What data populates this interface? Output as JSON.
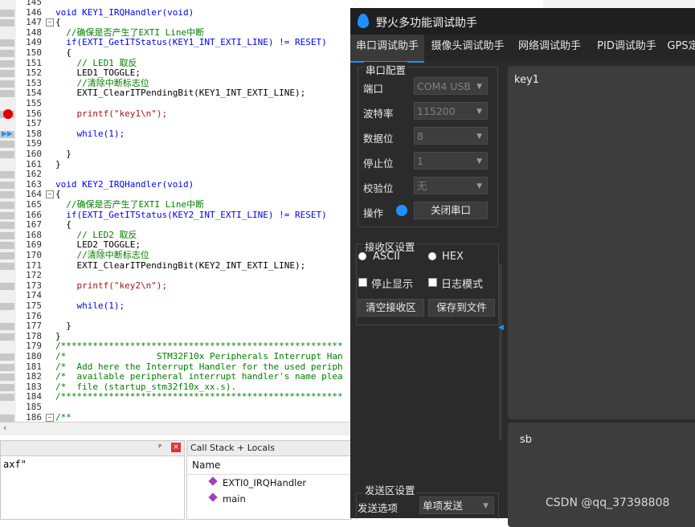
{
  "editor": {
    "lines": [
      {
        "n": "145",
        "t": ""
      },
      {
        "n": "146",
        "t": "void KEY1_IRQHandler(void)"
      },
      {
        "n": "147",
        "t": "{"
      },
      {
        "n": "148",
        "t": "  //确保是否产生了EXTI Line中断"
      },
      {
        "n": "149",
        "t": "  if(EXTI_GetITStatus(KEY1_INT_EXTI_LINE) != RESET)"
      },
      {
        "n": "150",
        "t": "  {"
      },
      {
        "n": "151",
        "t": "    // LED1 取反"
      },
      {
        "n": "152",
        "t": "    LED1_TOGGLE;"
      },
      {
        "n": "153",
        "t": "    //清除中断标志位"
      },
      {
        "n": "154",
        "t": "    EXTI_ClearITPendingBit(KEY1_INT_EXTI_LINE);"
      },
      {
        "n": "155",
        "t": ""
      },
      {
        "n": "156",
        "t": "    printf(\"key1\\n\");"
      },
      {
        "n": "157",
        "t": ""
      },
      {
        "n": "158",
        "t": "    while(1);"
      },
      {
        "n": "159",
        "t": ""
      },
      {
        "n": "160",
        "t": "  }"
      },
      {
        "n": "161",
        "t": "}"
      },
      {
        "n": "162",
        "t": ""
      },
      {
        "n": "163",
        "t": "void KEY2_IRQHandler(void)"
      },
      {
        "n": "164",
        "t": "{"
      },
      {
        "n": "165",
        "t": "  //确保是否产生了EXTI Line中断"
      },
      {
        "n": "166",
        "t": "  if(EXTI_GetITStatus(KEY2_INT_EXTI_LINE) != RESET)"
      },
      {
        "n": "167",
        "t": "  {"
      },
      {
        "n": "168",
        "t": "    // LED2 取反"
      },
      {
        "n": "169",
        "t": "    LED2_TOGGLE;"
      },
      {
        "n": "170",
        "t": "    //清除中断标志位"
      },
      {
        "n": "171",
        "t": "    EXTI_ClearITPendingBit(KEY2_INT_EXTI_LINE);"
      },
      {
        "n": "172",
        "t": ""
      },
      {
        "n": "173",
        "t": "    printf(\"key2\\n\");"
      },
      {
        "n": "174",
        "t": ""
      },
      {
        "n": "175",
        "t": "    while(1);"
      },
      {
        "n": "176",
        "t": ""
      },
      {
        "n": "177",
        "t": "  }"
      },
      {
        "n": "178",
        "t": "}"
      },
      {
        "n": "179",
        "t": "/*****************************************************"
      },
      {
        "n": "180",
        "t": "/*                 STM32F10x Peripherals Interrupt Han"
      },
      {
        "n": "181",
        "t": "/*  Add here the Interrupt Handler for the used periph"
      },
      {
        "n": "182",
        "t": "/*  available peripheral interrupt handler's name plea"
      },
      {
        "n": "183",
        "t": "/*  file (startup_stm32f10x_xx.s)."
      },
      {
        "n": "184",
        "t": "/*****************************************************"
      },
      {
        "n": "185",
        "t": ""
      },
      {
        "n": "186",
        "t": "/**"
      }
    ]
  },
  "output": {
    "text": "axf\""
  },
  "callstack": {
    "title": "Call Stack + Locals",
    "col_name": "Name",
    "rows": [
      "EXTI0_IRQHandler",
      "main"
    ],
    "pin_glyph": "ꟷ",
    "close_glyph": "×"
  },
  "tool": {
    "title": "野火多功能调试助手",
    "tabs": [
      "串口调试助手",
      "摄像头调试助手",
      "网络调试助手",
      "PID调试助手",
      "GPS定"
    ],
    "serial_config": {
      "title": "串口配置",
      "port_label": "端口",
      "port_value": "COM4 USB",
      "baud_label": "波特率",
      "baud_value": "115200",
      "data_label": "数据位",
      "data_value": "8",
      "stop_label": "停止位",
      "stop_value": "1",
      "parity_label": "校验位",
      "parity_value": "无",
      "op_label": "操作",
      "close_port": "关闭串口",
      "status_color": "#1e90ff"
    },
    "recv_settings": {
      "title": "接收区设置",
      "ascii": "ASCII",
      "hex": "HEX",
      "stop_display": "停止显示",
      "log_mode": "日志模式",
      "clear_btn": "清空接收区",
      "save_btn": "保存到文件"
    },
    "send_settings": {
      "title": "发送区设置",
      "option_label": "发送选项",
      "option_value": "单项发送"
    },
    "recv_text": "key1",
    "send_text": "sb"
  },
  "watermark": "CSDN @qq_37398808"
}
